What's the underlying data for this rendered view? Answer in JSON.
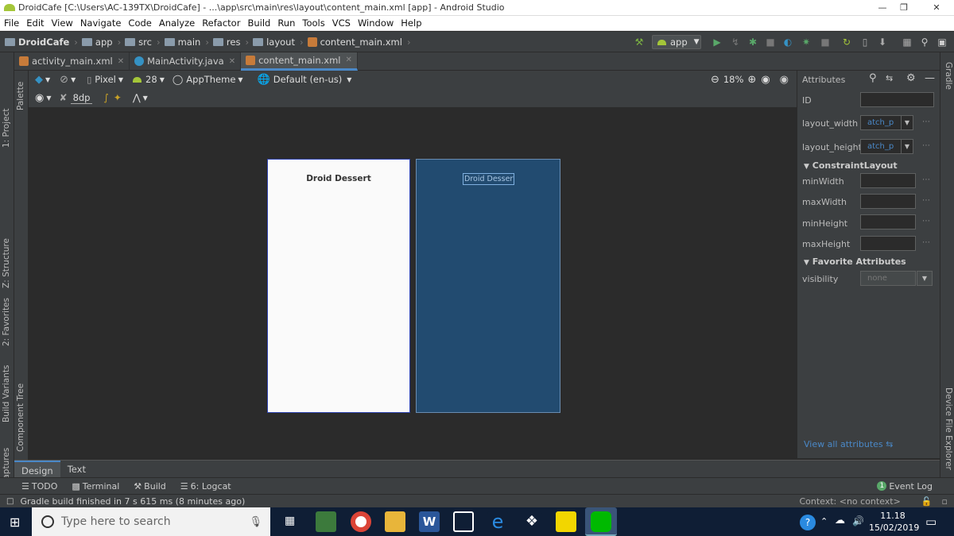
{
  "window": {
    "title": "DroidCafe [C:\\Users\\AC-139TX\\DroidCafe] - ...\\app\\src\\main\\res\\layout\\content_main.xml [app] - Android Studio"
  },
  "menu": [
    "File",
    "Edit",
    "View",
    "Navigate",
    "Code",
    "Analyze",
    "Refactor",
    "Build",
    "Run",
    "Tools",
    "VCS",
    "Window",
    "Help"
  ],
  "breadcrumb": [
    "DroidCafe",
    "app",
    "src",
    "main",
    "res",
    "layout",
    "content_main.xml"
  ],
  "run_config": "app",
  "editor_tabs": [
    {
      "label": "activity_main.xml",
      "active": false
    },
    {
      "label": "MainActivity.java",
      "active": false
    },
    {
      "label": "content_main.xml",
      "active": true
    }
  ],
  "left_tools": {
    "project": "1: Project",
    "palette": "Palette",
    "structure": "Z: Structure",
    "favorites": "2: Favorites",
    "build_variants": "Build Variants",
    "layout_captures": "Layout Captures",
    "component_tree": "Component Tree"
  },
  "right_tools": {
    "gradle": "Gradle",
    "device_explorer": "Device File Explorer"
  },
  "design_toolbar": {
    "device": "Pixel",
    "api": "28",
    "theme": "AppTheme",
    "locale": "Default (en-us)",
    "zoom": "18%",
    "margin": "8dp"
  },
  "preview": {
    "design_text": "Droid Dessert",
    "blueprint_text": "Droid Dessert"
  },
  "attributes": {
    "title": "Attributes",
    "id_label": "ID",
    "layout_width_label": "layout_width",
    "layout_width_value": "atch_p",
    "layout_height_label": "layout_height",
    "layout_height_value": "atch_p",
    "section_constraint": "ConstraintLayout",
    "min_width": "minWidth",
    "max_width": "maxWidth",
    "min_height": "minHeight",
    "max_height": "maxHeight",
    "section_favorite": "Favorite Attributes",
    "visibility_label": "visibility",
    "visibility_value": "none",
    "view_all": "View all attributes"
  },
  "bottom_tabs": [
    "Design",
    "Text"
  ],
  "tool_windows": {
    "todo": "TODO",
    "terminal": "Terminal",
    "build": "Build",
    "logcat": "6: Logcat",
    "event_log": "Event Log",
    "event_count": "1"
  },
  "status": {
    "message": "Gradle build finished in 7 s 615 ms (8 minutes ago)",
    "context": "Context: <no context>"
  },
  "taskbar": {
    "search_placeholder": "Type here to search",
    "time": "11.18",
    "date": "15/02/2019"
  },
  "colors": {
    "accent": "#4a88c7",
    "blueprint": "#224b70",
    "android_green": "#a4c639"
  }
}
